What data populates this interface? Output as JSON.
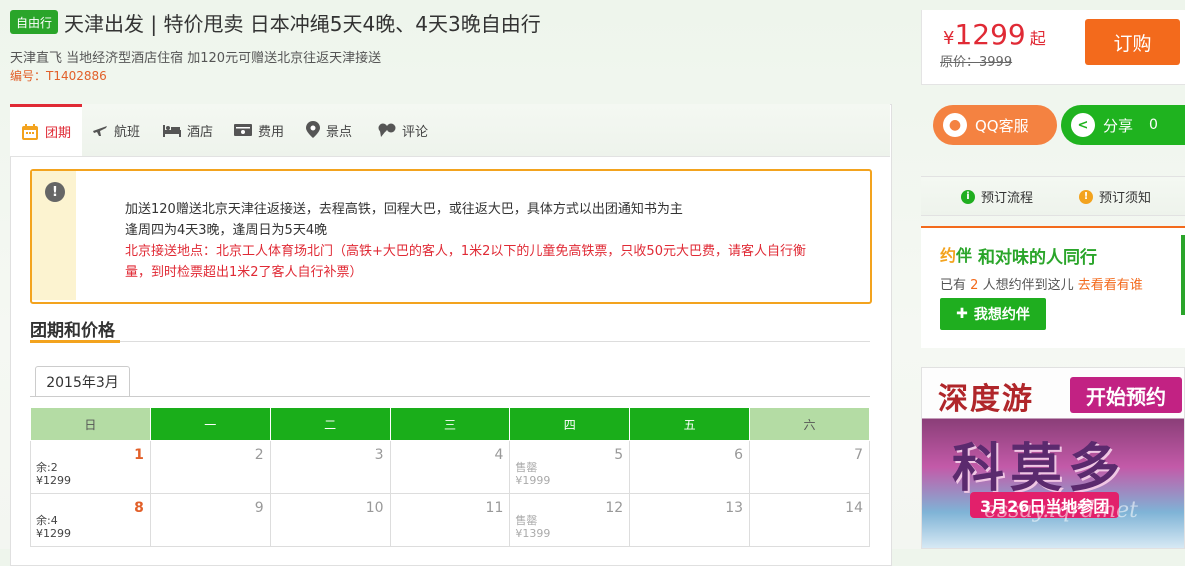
{
  "header": {
    "tag": "自由行",
    "title": "天津出发 | 特价甩卖 日本冲绳5天4晚、4天3晚自由行",
    "subtitle": "天津直飞 当地经济型酒店住宿 加120元可赠送北京往返天津接送",
    "code": "编号：T1402886"
  },
  "price": {
    "currency": "¥",
    "amount": "1299",
    "suffix": "起",
    "original": "原价：3999",
    "buy_label": "订购"
  },
  "tabs": [
    {
      "label": "团期",
      "icon": "calendar-icon",
      "active": true
    },
    {
      "label": "航班",
      "icon": "airplane-icon"
    },
    {
      "label": "酒店",
      "icon": "bed-icon"
    },
    {
      "label": "费用",
      "icon": "money-icon"
    },
    {
      "label": "景点",
      "icon": "location-pin-icon"
    },
    {
      "label": "评论",
      "icon": "comment-icon"
    }
  ],
  "notice": {
    "icon": "exclamation-icon",
    "line1": "加送120赠送北京天津往返接送，去程高铁，回程大巴，或往返大巴，具体方式以出团通知书为主",
    "line2": "逢周四为4天3晚，逢周日为5天4晚",
    "line3": "北京接送地点：北京工人体育场北门（高铁+大巴的客人，1米2以下的儿童免高铁票，只收50元大巴费，请客人自行衡",
    "line4": "量，到时检票超出1米2了客人自行补票）"
  },
  "section": {
    "title": "团期和价格",
    "month_tab": "2015年3月"
  },
  "calendar": {
    "weekdays": [
      "日",
      "一",
      "二",
      "三",
      "四",
      "五",
      "六"
    ],
    "weeks": [
      [
        {
          "day": "1",
          "hot": true,
          "line1": "余:2",
          "line2": "¥1299"
        },
        {
          "day": "2"
        },
        {
          "day": "3"
        },
        {
          "day": "4"
        },
        {
          "day": "5",
          "sold": true,
          "line1": "售罄",
          "line2": "¥1999"
        },
        {
          "day": "6"
        },
        {
          "day": "7"
        }
      ],
      [
        {
          "day": "8",
          "hot": true,
          "line1": "余:4",
          "line2": "¥1299"
        },
        {
          "day": "9"
        },
        {
          "day": "10"
        },
        {
          "day": "11"
        },
        {
          "day": "12",
          "sold": true,
          "line1": "售罄",
          "line2": "¥1399"
        },
        {
          "day": "13"
        },
        {
          "day": "14"
        }
      ]
    ]
  },
  "sidebar": {
    "qq_label": "QQ客服",
    "share_label": "分享",
    "share_count": "0",
    "process_label": "预订流程",
    "notice_label": "预订须知",
    "yueban_logo_a": "约",
    "yueban_logo_b": "伴",
    "yueban_title": "和对味的人同行",
    "yueban_prefix": "已有",
    "yueban_count": "2",
    "yueban_mid": "人想约伴到这儿",
    "yueban_link": "去看看有谁",
    "yueban_btn": "我想约伴"
  },
  "ad": {
    "brand": "深度游",
    "cta": "开始预约",
    "headline": "科莫多",
    "date_line": "3月26日当地参团",
    "watermark": "essay.lqrd.net"
  },
  "colors": {
    "green": "#1aae1a",
    "orange": "#f36a1c",
    "red": "#e02a35",
    "amber": "#f3a31e"
  }
}
